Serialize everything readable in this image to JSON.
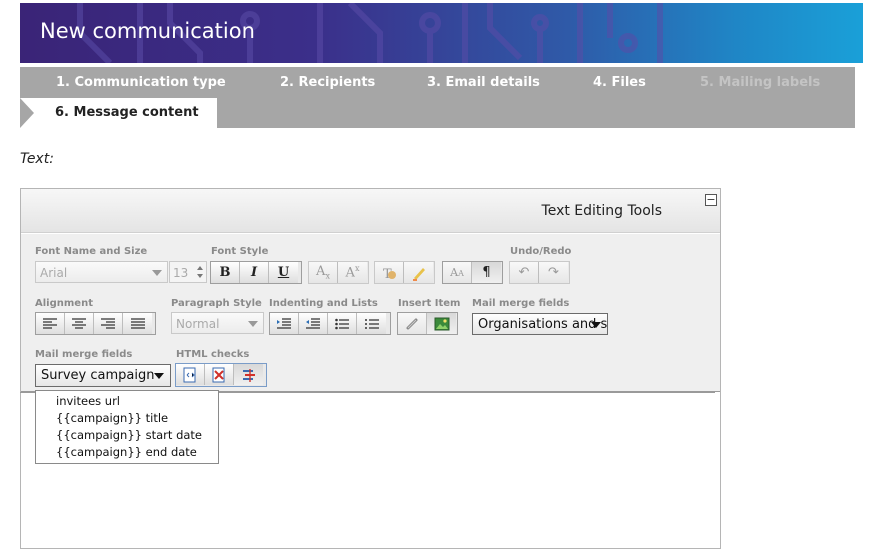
{
  "header": {
    "title": "New communication"
  },
  "steps": [
    {
      "label": "1. Communication type",
      "state": "done"
    },
    {
      "label": "2. Recipients",
      "state": "done"
    },
    {
      "label": "3. Email details",
      "state": "done"
    },
    {
      "label": "4. Files",
      "state": "done"
    },
    {
      "label": "5. Mailing labels",
      "state": "disabled"
    },
    {
      "label": "6. Message content",
      "state": "active"
    }
  ],
  "text_label": "Text:",
  "editor": {
    "tools_title": "Text Editing Tools",
    "collapse_glyph": "−",
    "groups": {
      "font_name_size": "Font Name and Size",
      "font_style": "Font Style",
      "undo_redo": "Undo/Redo",
      "alignment": "Alignment",
      "paragraph_style": "Paragraph Style",
      "indenting_lists": "Indenting and Lists",
      "insert_item": "Insert Item",
      "mail_merge_fields_1": "Mail merge fields",
      "mail_merge_fields_2": "Mail merge fields",
      "html_checks": "HTML checks"
    },
    "font_name": "Arial",
    "font_size": "13",
    "paragraph_style": "Normal",
    "style_buttons": {
      "bold": "B",
      "italic": "I",
      "underline": "U"
    },
    "mail_merge_select_1": "Organisations and se",
    "mail_merge_select_2": "Survey campaign",
    "dropdown_options": [
      "invitees url",
      "{{campaign}} title",
      "{{campaign}} start date",
      "{{campaign}} end date"
    ]
  },
  "colors": {
    "steps_bg": "#a6a6a6",
    "header_start": "#3a2477",
    "header_end": "#1aa0d8"
  }
}
